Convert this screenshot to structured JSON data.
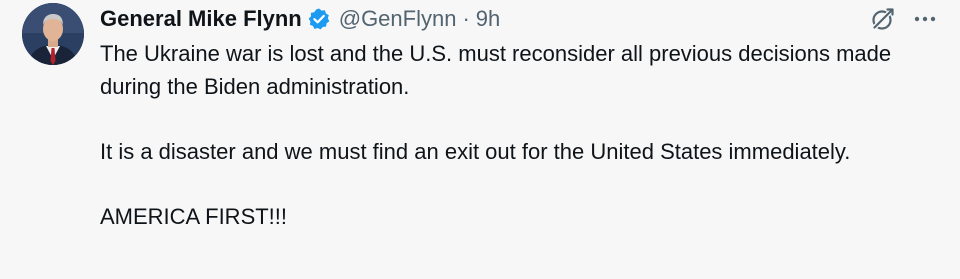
{
  "author": {
    "name": "General Mike Flynn",
    "handle": "@GenFlynn",
    "separator": "·",
    "time": "9h",
    "verified": true,
    "verified_color": "#1d9bf0"
  },
  "post": {
    "paragraphs": [
      "The Ukraine war is lost and the U.S. must reconsider all previous decisions made during the Biden administration.",
      "It is a disaster and we must find an exit out for the United States immediately.",
      "AMERICA FIRST!!!"
    ]
  },
  "icons": {
    "verified": "verified-badge-icon",
    "grok": "grok-icon",
    "more": "more-options-icon"
  },
  "colors": {
    "background": "#f7f7f7",
    "text": "#0f1419",
    "secondary": "#536471",
    "accent": "#1d9bf0"
  }
}
